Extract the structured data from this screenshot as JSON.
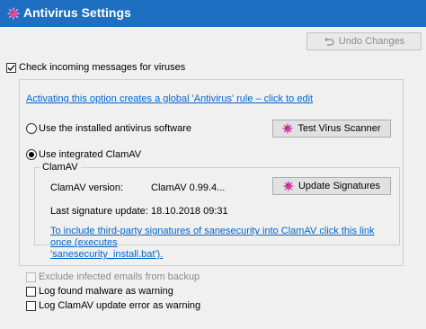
{
  "window": {
    "title": "Antivirus Settings"
  },
  "toolbar": {
    "undo_label": "Undo Changes"
  },
  "main": {
    "check_incoming_label": "Check incoming messages for viruses",
    "activating_link": "Activating this option creates a global 'Antivirus' rule – click to edit",
    "use_installed_label": "Use the installed antivirus software",
    "test_scanner_label": "Test Virus Scanner",
    "use_integrated_label": "Use integrated ClamAV"
  },
  "clamav": {
    "group_title": "ClamAV",
    "version_label": "ClamAV version:",
    "version_value": "ClamAV 0.99.4...",
    "update_signatures_label": "Update Signatures",
    "last_update_label": "Last signature update:",
    "last_update_value": "18.10.2018 09:31",
    "third_party_link_line1": "To include third-party signatures of sanesecurity into ClamAV click this link once (executes",
    "third_party_link_line2": "'sanesecurity_install.bat')."
  },
  "options": {
    "exclude_backup_label": "Exclude infected emails from backup",
    "log_malware_label": "Log found malware as warning",
    "log_update_error_label": "Log ClamAV update error as warning"
  },
  "state": {
    "check_incoming": true,
    "selected_engine": "integrated",
    "exclude_backup": false,
    "exclude_backup_enabled": false,
    "log_malware": false,
    "log_update_error": false
  },
  "colors": {
    "titlebar": "#1e6fc1",
    "link": "#0066cc",
    "icon_pink": "#d63aa8"
  },
  "icons": {
    "title": "virus-icon",
    "undo": "undo-icon",
    "test": "virus-icon",
    "update": "virus-icon"
  }
}
